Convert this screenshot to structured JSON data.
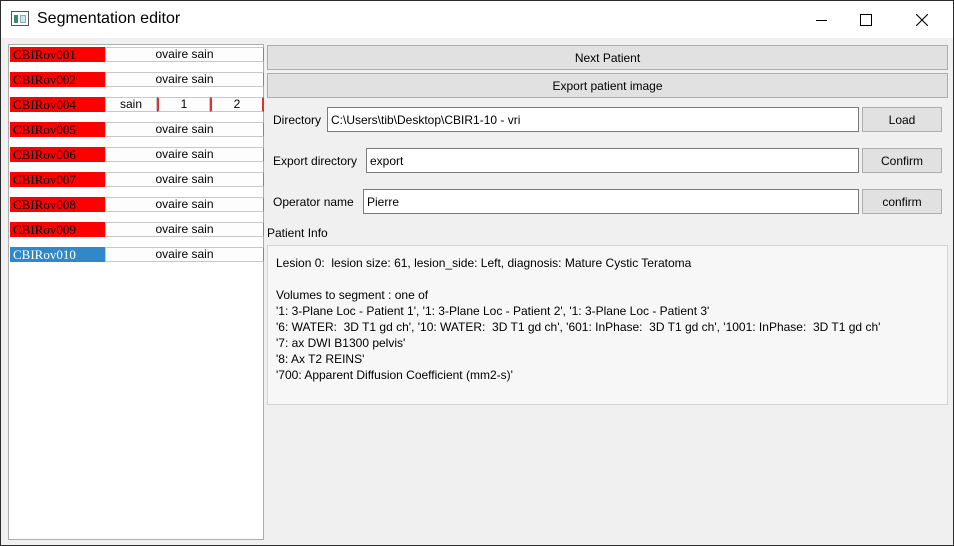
{
  "window": {
    "title": "Segmentation editor"
  },
  "patients": [
    {
      "id": "CBIRov001",
      "status": "ovaire sain",
      "selected": false
    },
    {
      "id": "CBIRov002",
      "status": "ovaire sain",
      "selected": false
    },
    {
      "id": "CBIRov004",
      "cells": [
        "sain",
        "1",
        "2"
      ],
      "selected": false
    },
    {
      "id": "CBIRov005",
      "status": "ovaire sain",
      "selected": false
    },
    {
      "id": "CBIRov006",
      "status": "ovaire sain",
      "selected": false
    },
    {
      "id": "CBIRov007",
      "status": "ovaire sain",
      "selected": false
    },
    {
      "id": "CBIRov008",
      "status": "ovaire sain",
      "selected": false
    },
    {
      "id": "CBIRov009",
      "status": "ovaire sain",
      "selected": false
    },
    {
      "id": "CBIRov010",
      "status": "ovaire sain",
      "selected": true
    }
  ],
  "actions": {
    "next_patient": "Next Patient",
    "export_image": "Export patient image"
  },
  "directory": {
    "label": "Directory",
    "value": "C:\\Users\\tib\\Desktop\\CBIR1-10 - vri",
    "button": "Load"
  },
  "export_directory": {
    "label": "Export directory",
    "value": "export",
    "button": "Confirm"
  },
  "operator": {
    "label": "Operator name",
    "value": "Pierre",
    "button": "confirm"
  },
  "patient_info": {
    "heading": "Patient Info",
    "lines": [
      "Lesion 0:  lesion size: 61, lesion_side: Left, diagnosis: Mature Cystic Teratoma",
      "",
      "Volumes to segment : one of",
      "'1: 3-Plane Loc - Patient 1', '1: 3-Plane Loc - Patient 2', '1: 3-Plane Loc - Patient 3'",
      "'6: WATER:  3D T1 gd ch', '10: WATER:  3D T1 gd ch', '601: InPhase:  3D T1 gd ch', '1001: InPhase:  3D T1 gd ch'",
      "'7: ax DWI B1300 pelvis'",
      "'8: Ax T2 REINS'",
      "'700: Apparent Diffusion Coefficient (mm2-s)'"
    ]
  },
  "colors": {
    "flag_red": "#ff0000",
    "selected_blue": "#3088c8"
  }
}
